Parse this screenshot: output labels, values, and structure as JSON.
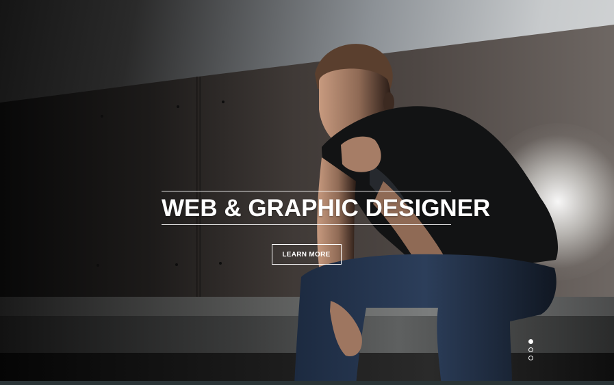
{
  "hero": {
    "headline": "WEB & GRAPHIC DESIGNER",
    "cta_label": "LEARN MORE",
    "slides": [
      {
        "active": true
      },
      {
        "active": false
      },
      {
        "active": false
      }
    ]
  },
  "colors": {
    "text": "#ffffff",
    "overlay_dark": "#111111",
    "bottom_strip": "#2a3436"
  }
}
